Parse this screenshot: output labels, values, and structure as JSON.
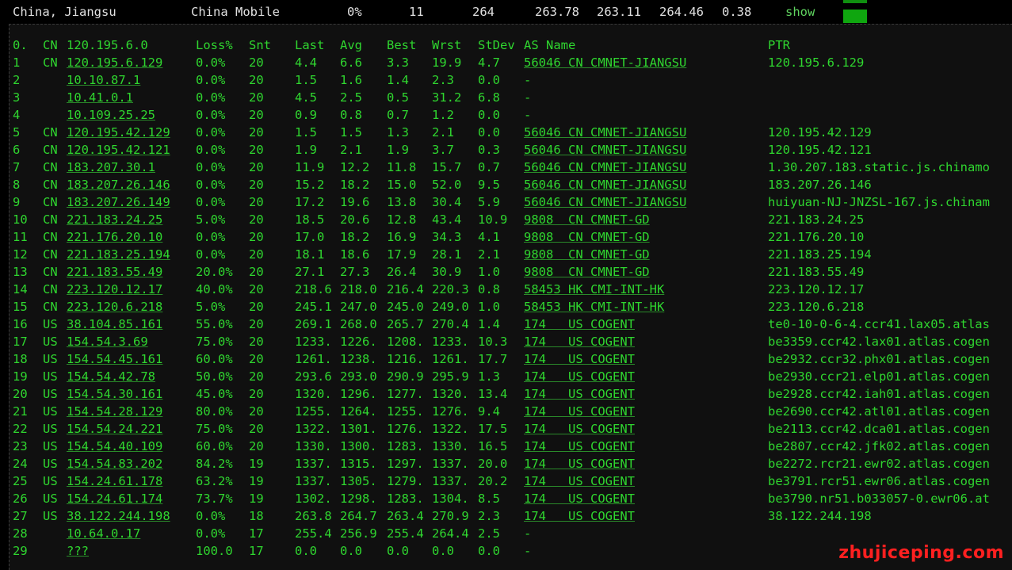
{
  "summary": {
    "location": "China, Jiangsu",
    "isp": "China Mobile",
    "loss": "0%",
    "hops": "11",
    "snt": "264",
    "last": "263.78",
    "avg": "263.11",
    "best": "264.46",
    "stdev": "0.38",
    "show_label": "show"
  },
  "table": {
    "headers": {
      "idx": "0.",
      "cc": "CN",
      "host": "120.195.6.0",
      "loss": "Loss%",
      "snt": "Snt",
      "last": "Last",
      "avg": "Avg",
      "best": "Best",
      "wrst": "Wrst",
      "stdev": "StDev",
      "as": "AS Name",
      "ptr": "PTR"
    },
    "rows": [
      {
        "idx": "1",
        "cc": "CN",
        "host": "120.195.6.129",
        "loss": "0.0%",
        "snt": "20",
        "last": "4.4",
        "avg": "6.6",
        "best": "3.3",
        "wrst": "19.9",
        "stdev": "4.7",
        "as": "56046 CN CMNET-JIANGSU",
        "ptr": "120.195.6.129"
      },
      {
        "idx": "2",
        "cc": "",
        "host": "10.10.87.1",
        "loss": "0.0%",
        "snt": "20",
        "last": "1.5",
        "avg": "1.6",
        "best": "1.4",
        "wrst": "2.3",
        "stdev": "0.0",
        "as": "-",
        "ptr": ""
      },
      {
        "idx": "3",
        "cc": "",
        "host": "10.41.0.1",
        "loss": "0.0%",
        "snt": "20",
        "last": "4.5",
        "avg": "2.5",
        "best": "0.5",
        "wrst": "31.2",
        "stdev": "6.8",
        "as": "-",
        "ptr": ""
      },
      {
        "idx": "4",
        "cc": "",
        "host": "10.109.25.25",
        "loss": "0.0%",
        "snt": "20",
        "last": "0.9",
        "avg": "0.8",
        "best": "0.7",
        "wrst": "1.2",
        "stdev": "0.0",
        "as": "-",
        "ptr": ""
      },
      {
        "idx": "5",
        "cc": "CN",
        "host": "120.195.42.129",
        "loss": "0.0%",
        "snt": "20",
        "last": "1.5",
        "avg": "1.5",
        "best": "1.3",
        "wrst": "2.1",
        "stdev": "0.0",
        "as": "56046 CN CMNET-JIANGSU",
        "ptr": "120.195.42.129"
      },
      {
        "idx": "6",
        "cc": "CN",
        "host": "120.195.42.121",
        "loss": "0.0%",
        "snt": "20",
        "last": "1.9",
        "avg": "2.1",
        "best": "1.9",
        "wrst": "3.7",
        "stdev": "0.3",
        "as": "56046 CN CMNET-JIANGSU",
        "ptr": "120.195.42.121"
      },
      {
        "idx": "7",
        "cc": "CN",
        "host": "183.207.30.1",
        "loss": "0.0%",
        "snt": "20",
        "last": "11.9",
        "avg": "12.2",
        "best": "11.8",
        "wrst": "15.7",
        "stdev": "0.7",
        "as": "56046 CN CMNET-JIANGSU",
        "ptr": "1.30.207.183.static.js.chinamo"
      },
      {
        "idx": "8",
        "cc": "CN",
        "host": "183.207.26.146",
        "loss": "0.0%",
        "snt": "20",
        "last": "15.2",
        "avg": "18.2",
        "best": "15.0",
        "wrst": "52.0",
        "stdev": "9.5",
        "as": "56046 CN CMNET-JIANGSU",
        "ptr": "183.207.26.146"
      },
      {
        "idx": "9",
        "cc": "CN",
        "host": "183.207.26.149",
        "loss": "0.0%",
        "snt": "20",
        "last": "17.2",
        "avg": "19.6",
        "best": "13.8",
        "wrst": "30.4",
        "stdev": "5.9",
        "as": "56046 CN CMNET-JIANGSU",
        "ptr": "huiyuan-NJ-JNZSL-167.js.chinam"
      },
      {
        "idx": "10",
        "cc": "CN",
        "host": "221.183.24.25",
        "loss": "5.0%",
        "snt": "20",
        "last": "18.5",
        "avg": "20.6",
        "best": "12.8",
        "wrst": "43.4",
        "stdev": "10.9",
        "as": "9808  CN CMNET-GD",
        "ptr": "221.183.24.25"
      },
      {
        "idx": "11",
        "cc": "CN",
        "host": "221.176.20.10",
        "loss": "0.0%",
        "snt": "20",
        "last": "17.0",
        "avg": "18.2",
        "best": "16.9",
        "wrst": "34.3",
        "stdev": "4.1",
        "as": "9808  CN CMNET-GD",
        "ptr": "221.176.20.10"
      },
      {
        "idx": "12",
        "cc": "CN",
        "host": "221.183.25.194",
        "loss": "0.0%",
        "snt": "20",
        "last": "18.1",
        "avg": "18.6",
        "best": "17.9",
        "wrst": "28.1",
        "stdev": "2.1",
        "as": "9808  CN CMNET-GD",
        "ptr": "221.183.25.194"
      },
      {
        "idx": "13",
        "cc": "CN",
        "host": "221.183.55.49",
        "loss": "20.0%",
        "snt": "20",
        "last": "27.1",
        "avg": "27.3",
        "best": "26.4",
        "wrst": "30.9",
        "stdev": "1.0",
        "as": "9808  CN CMNET-GD",
        "ptr": "221.183.55.49"
      },
      {
        "idx": "14",
        "cc": "CN",
        "host": "223.120.12.17",
        "loss": "40.0%",
        "snt": "20",
        "last": "218.6",
        "avg": "218.0",
        "best": "216.4",
        "wrst": "220.3",
        "stdev": "0.8",
        "as": "58453 HK CMI-INT-HK",
        "ptr": "223.120.12.17"
      },
      {
        "idx": "15",
        "cc": "CN",
        "host": "223.120.6.218",
        "loss": "5.0%",
        "snt": "20",
        "last": "245.1",
        "avg": "247.0",
        "best": "245.0",
        "wrst": "249.0",
        "stdev": "1.0",
        "as": "58453 HK CMI-INT-HK",
        "ptr": "223.120.6.218"
      },
      {
        "idx": "16",
        "cc": "US",
        "host": "38.104.85.161",
        "loss": "55.0%",
        "snt": "20",
        "last": "269.1",
        "avg": "268.0",
        "best": "265.7",
        "wrst": "270.4",
        "stdev": "1.4",
        "as": "174   US COGENT",
        "ptr": "te0-10-0-6-4.ccr41.lax05.atlas"
      },
      {
        "idx": "17",
        "cc": "US",
        "host": "154.54.3.69",
        "loss": "75.0%",
        "snt": "20",
        "last": "1233.",
        "avg": "1226.",
        "best": "1208.",
        "wrst": "1233.",
        "stdev": "10.3",
        "as": "174   US COGENT",
        "ptr": "be3359.ccr42.lax01.atlas.cogen"
      },
      {
        "idx": "18",
        "cc": "US",
        "host": "154.54.45.161",
        "loss": "60.0%",
        "snt": "20",
        "last": "1261.",
        "avg": "1238.",
        "best": "1216.",
        "wrst": "1261.",
        "stdev": "17.7",
        "as": "174   US COGENT",
        "ptr": "be2932.ccr32.phx01.atlas.cogen"
      },
      {
        "idx": "19",
        "cc": "US",
        "host": "154.54.42.78",
        "loss": "50.0%",
        "snt": "20",
        "last": "293.6",
        "avg": "293.0",
        "best": "290.9",
        "wrst": "295.9",
        "stdev": "1.3",
        "as": "174   US COGENT",
        "ptr": "be2930.ccr21.elp01.atlas.cogen"
      },
      {
        "idx": "20",
        "cc": "US",
        "host": "154.54.30.161",
        "loss": "45.0%",
        "snt": "20",
        "last": "1320.",
        "avg": "1296.",
        "best": "1277.",
        "wrst": "1320.",
        "stdev": "13.4",
        "as": "174   US COGENT",
        "ptr": "be2928.ccr42.iah01.atlas.cogen"
      },
      {
        "idx": "21",
        "cc": "US",
        "host": "154.54.28.129",
        "loss": "80.0%",
        "snt": "20",
        "last": "1255.",
        "avg": "1264.",
        "best": "1255.",
        "wrst": "1276.",
        "stdev": "9.4",
        "as": "174   US COGENT",
        "ptr": "be2690.ccr42.atl01.atlas.cogen"
      },
      {
        "idx": "22",
        "cc": "US",
        "host": "154.54.24.221",
        "loss": "75.0%",
        "snt": "20",
        "last": "1322.",
        "avg": "1301.",
        "best": "1276.",
        "wrst": "1322.",
        "stdev": "17.5",
        "as": "174   US COGENT",
        "ptr": "be2113.ccr42.dca01.atlas.cogen"
      },
      {
        "idx": "23",
        "cc": "US",
        "host": "154.54.40.109",
        "loss": "60.0%",
        "snt": "20",
        "last": "1330.",
        "avg": "1300.",
        "best": "1283.",
        "wrst": "1330.",
        "stdev": "16.5",
        "as": "174   US COGENT",
        "ptr": "be2807.ccr42.jfk02.atlas.cogen"
      },
      {
        "idx": "24",
        "cc": "US",
        "host": "154.54.83.202",
        "loss": "84.2%",
        "snt": "19",
        "last": "1337.",
        "avg": "1315.",
        "best": "1297.",
        "wrst": "1337.",
        "stdev": "20.0",
        "as": "174   US COGENT",
        "ptr": "be2272.rcr21.ewr02.atlas.cogen"
      },
      {
        "idx": "25",
        "cc": "US",
        "host": "154.24.61.178",
        "loss": "63.2%",
        "snt": "19",
        "last": "1337.",
        "avg": "1305.",
        "best": "1279.",
        "wrst": "1337.",
        "stdev": "20.2",
        "as": "174   US COGENT",
        "ptr": "be3791.rcr51.ewr06.atlas.cogen"
      },
      {
        "idx": "26",
        "cc": "US",
        "host": "154.24.61.174",
        "loss": "73.7%",
        "snt": "19",
        "last": "1302.",
        "avg": "1298.",
        "best": "1283.",
        "wrst": "1304.",
        "stdev": "8.5",
        "as": "174   US COGENT",
        "ptr": "be3790.nr51.b033057-0.ewr06.at"
      },
      {
        "idx": "27",
        "cc": "US",
        "host": "38.122.244.198",
        "loss": "0.0%",
        "snt": "18",
        "last": "263.8",
        "avg": "264.7",
        "best": "263.4",
        "wrst": "270.9",
        "stdev": "2.3",
        "as": "174   US COGENT",
        "ptr": "38.122.244.198"
      },
      {
        "idx": "28",
        "cc": "",
        "host": "10.64.0.17",
        "loss": "0.0%",
        "snt": "17",
        "last": "255.4",
        "avg": "256.9",
        "best": "255.4",
        "wrst": "264.4",
        "stdev": "2.5",
        "as": "-",
        "ptr": ""
      },
      {
        "idx": "29",
        "cc": "",
        "host": "???",
        "loss": "100.0",
        "snt": "17",
        "last": "0.0",
        "avg": "0.0",
        "best": "0.0",
        "wrst": "0.0",
        "stdev": "0.0",
        "as": "-",
        "ptr": ""
      }
    ]
  },
  "watermark": "zhujiceping.com"
}
